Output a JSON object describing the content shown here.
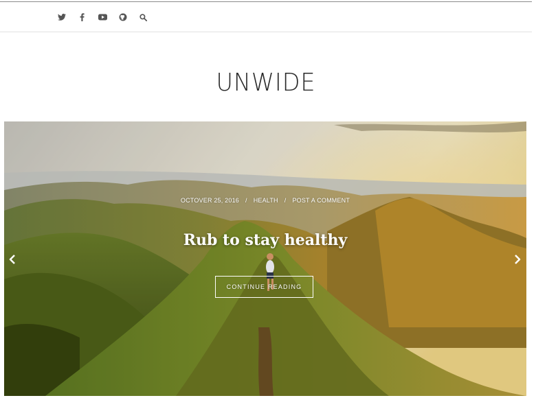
{
  "header": {
    "social_icons": [
      "twitter-icon",
      "facebook-icon",
      "youtube-icon",
      "github-icon",
      "search-icon"
    ]
  },
  "site": {
    "title": "UNWIDE"
  },
  "slider": {
    "post": {
      "date": "OCTOVER 25, 2016",
      "separator": "/",
      "category": "HEALTH",
      "comment_link": "POST A COMMENT",
      "title": "Rub to stay healthy",
      "button_label": "CONTINUE READING"
    },
    "prev_icon": "chevron-left-icon",
    "next_icon": "chevron-right-icon"
  },
  "colors": {
    "icon": "#555555",
    "title_text": "#2a2a2a",
    "overlay_text": "#ffffff"
  }
}
